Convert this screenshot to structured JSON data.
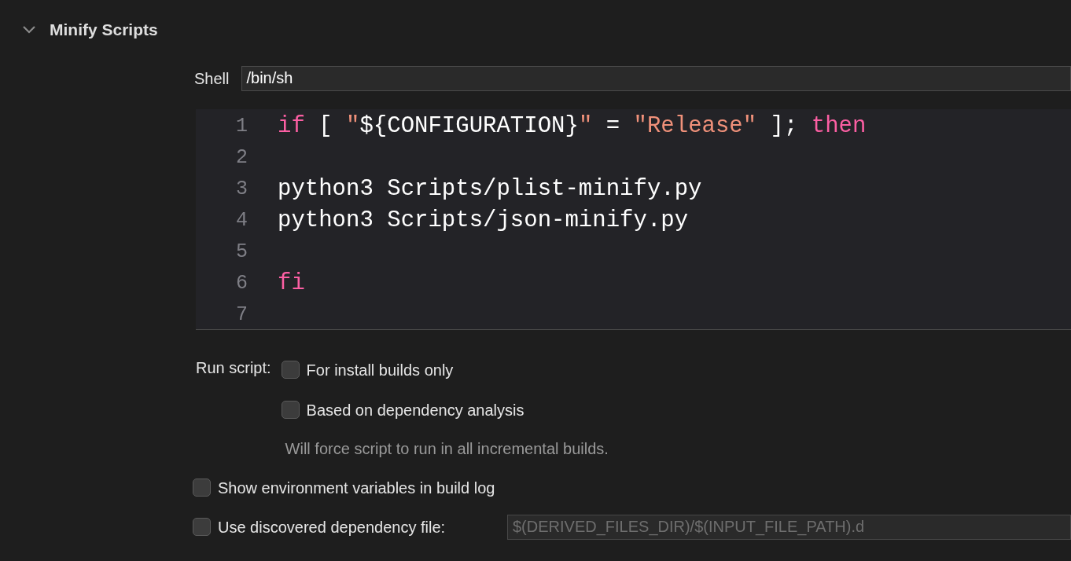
{
  "section": {
    "title": "Minify Scripts",
    "expanded": true
  },
  "shell": {
    "label": "Shell",
    "value": "/bin/sh"
  },
  "editor": {
    "lines": [
      {
        "number": "1",
        "tokens": [
          {
            "kind": "keyword",
            "text": "if"
          },
          {
            "kind": "plain",
            "text": " [ "
          },
          {
            "kind": "string",
            "text": "\""
          },
          {
            "kind": "plain",
            "text": "${CONFIGURATION}"
          },
          {
            "kind": "string",
            "text": "\""
          },
          {
            "kind": "plain",
            "text": " = "
          },
          {
            "kind": "string",
            "text": "\"Release\""
          },
          {
            "kind": "plain",
            "text": " ]; "
          },
          {
            "kind": "keyword",
            "text": "then"
          }
        ]
      },
      {
        "number": "2"
      },
      {
        "number": "3",
        "tokens": [
          {
            "kind": "plain",
            "text": "python3 Scripts/plist-minify.py"
          }
        ]
      },
      {
        "number": "4",
        "tokens": [
          {
            "kind": "plain",
            "text": "python3 Scripts/json-minify.py"
          }
        ]
      },
      {
        "number": "5"
      },
      {
        "number": "6",
        "tokens": [
          {
            "kind": "keyword",
            "text": "fi"
          }
        ]
      },
      {
        "number": "7"
      }
    ]
  },
  "run_script": {
    "label": "Run script:",
    "options": [
      {
        "label": "For install builds only",
        "checked": false
      },
      {
        "label": "Based on dependency analysis",
        "checked": false
      }
    ],
    "note": "Will force script to run in all incremental builds."
  },
  "show_env": {
    "label": "Show environment variables in build log",
    "checked": false
  },
  "dependency_file": {
    "label": "Use discovered dependency file:",
    "checked": false,
    "placeholder": "$(DERIVED_FILES_DIR)/$(INPUT_FILE_PATH).d"
  }
}
